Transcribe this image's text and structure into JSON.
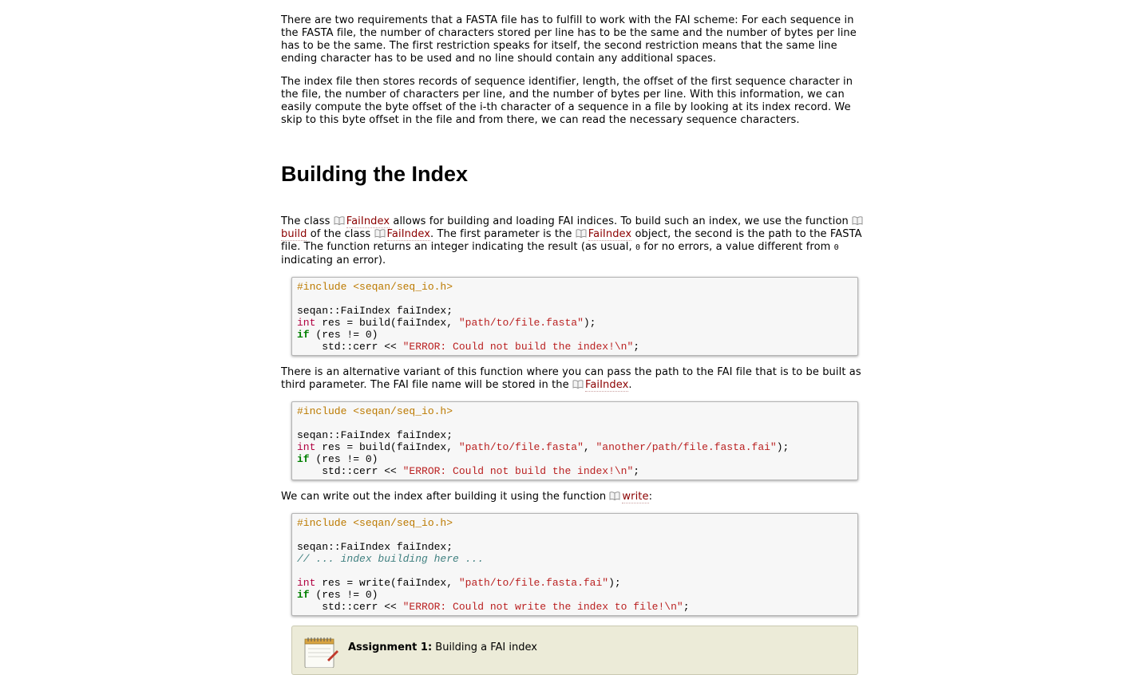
{
  "intro": {
    "para1": "There are two requirements that a FASTA file has to fulfill to work with the FAI scheme: For each sequence in the FASTA file, the number of characters stored per line has to be the same and the number of bytes per line has to be the same. The first restriction speaks for itself, the second restriction means that the same line ending character has to be used and no line should contain any additional spaces.",
    "para2": "The index file then stores records of sequence identifier, length, the offset of the first sequence character in the file, the number of characters per line, and the number of bytes per line. With this information, we can easily compute the byte offset of the i-th character of a sequence in a file by looking at its index record. We skip to this byte offset in the file and from there, we can read the necessary sequence characters."
  },
  "section": {
    "heading": "Building the Index",
    "p3": {
      "t1": "The class ",
      "ref1": "FaiIndex",
      "t2": " allows for building and loading FAI indices. To build such an index, we use the function ",
      "ref2": "build",
      "t3": " of the class ",
      "ref3": "FaiIndex",
      "t4": ". The first parameter is the ",
      "ref4": "FaiIndex",
      "t5": " object, the second is the path to the FASTA file. The function returns an integer indicating the result (as usual, ",
      "lit1": "0",
      "t6": " for no errors, a value different from ",
      "lit2": "0",
      "t7": " indicating an error)."
    },
    "p4": {
      "t1": "There is an alternative variant of this function where you can pass the path to the FAI file that is to be built as third parameter. The FAI file name will be stored in the ",
      "ref1": "FaiIndex",
      "t2": "."
    },
    "p5": {
      "t1": "We can write out the index after building it using the function ",
      "ref1": "write",
      "t2": ":"
    }
  },
  "code": {
    "include": "#include <seqan/seq_io.h>",
    "decl": "seqan::FaiIndex faiIndex;",
    "kw_int": "int",
    "kw_if": "if",
    "build_call": " res = build(faiIndex, ",
    "path_fasta": "\"path/to/file.fasta\"",
    "path_fai_other": "\"another/path/file.fasta.fai\"",
    "comma": ", ",
    "end_call": ");",
    "cond": " (res != 0)",
    "cerr": "    std::cerr << ",
    "err_build": "\"ERROR: Could not build the index!\\n\"",
    "semicolon": ";",
    "comment": "// ... index building here ...",
    "write_call": " res = write(faiIndex, ",
    "path_fai": "\"path/to/file.fasta.fai\"",
    "err_write": "\"ERROR: Could not write the index to file!\\n\""
  },
  "assignment": {
    "label": "Assignment 1:",
    "title": " Building a FAI index",
    "icon": "notepad-icon"
  },
  "colors": {
    "link": "#8b0000",
    "preprocessor": "#bc7a00",
    "keyword": "#008000",
    "type": "#b00040",
    "string": "#ba2121",
    "comment": "#408080",
    "assignment_bg": "#ecebd8"
  }
}
